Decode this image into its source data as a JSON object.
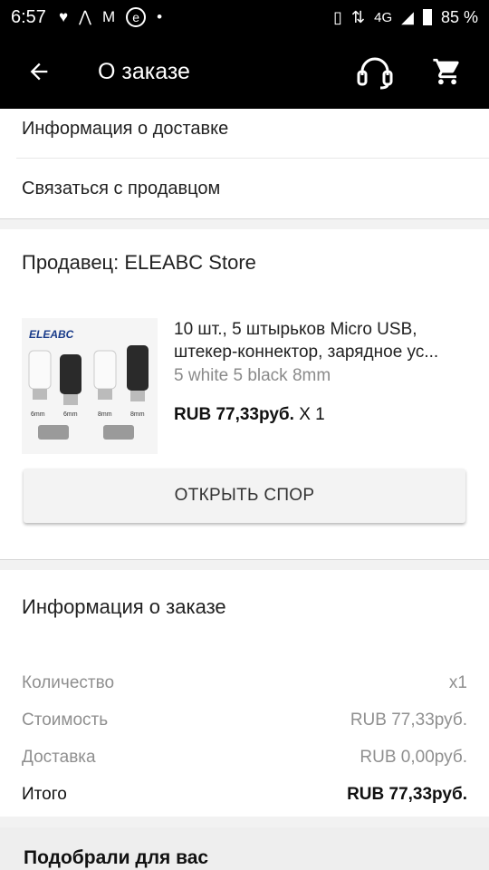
{
  "status_bar": {
    "time": "6:57",
    "network": "4G",
    "battery": "85 %"
  },
  "toolbar": {
    "title": "О заказе"
  },
  "links": {
    "delivery_info": "Информация о доставке",
    "contact_seller": "Связаться с продавцом"
  },
  "seller": {
    "label": "Продавец: ELEABC Store"
  },
  "product": {
    "brand_logo": "ELEABC",
    "name": "10 шт., 5 штырьков Micro USB, штекер-коннектор, зарядное ус...",
    "name_line1": "10 шт., 5 штырьков Micro USB,",
    "name_line2": "штекер-коннектор, зарядное ус...",
    "variant": "5 white 5 black 8mm",
    "price": "RUB 77,33руб.",
    "quantity": " X 1",
    "thumb_labels": [
      "6mm",
      "6mm",
      "8mm",
      "8mm"
    ]
  },
  "dispute_button": "ОТКРЫТЬ СПОР",
  "order_info": {
    "title": "Информация о заказе",
    "rows": [
      {
        "label": "Количество",
        "value": "x1"
      },
      {
        "label": "Стоимость",
        "value": "RUB 77,33руб."
      },
      {
        "label": "Доставка",
        "value": "RUB 0,00руб."
      },
      {
        "label": "Итого",
        "value": "RUB 77,33руб."
      }
    ]
  },
  "recommend": {
    "title": "Подобрали для вас"
  }
}
